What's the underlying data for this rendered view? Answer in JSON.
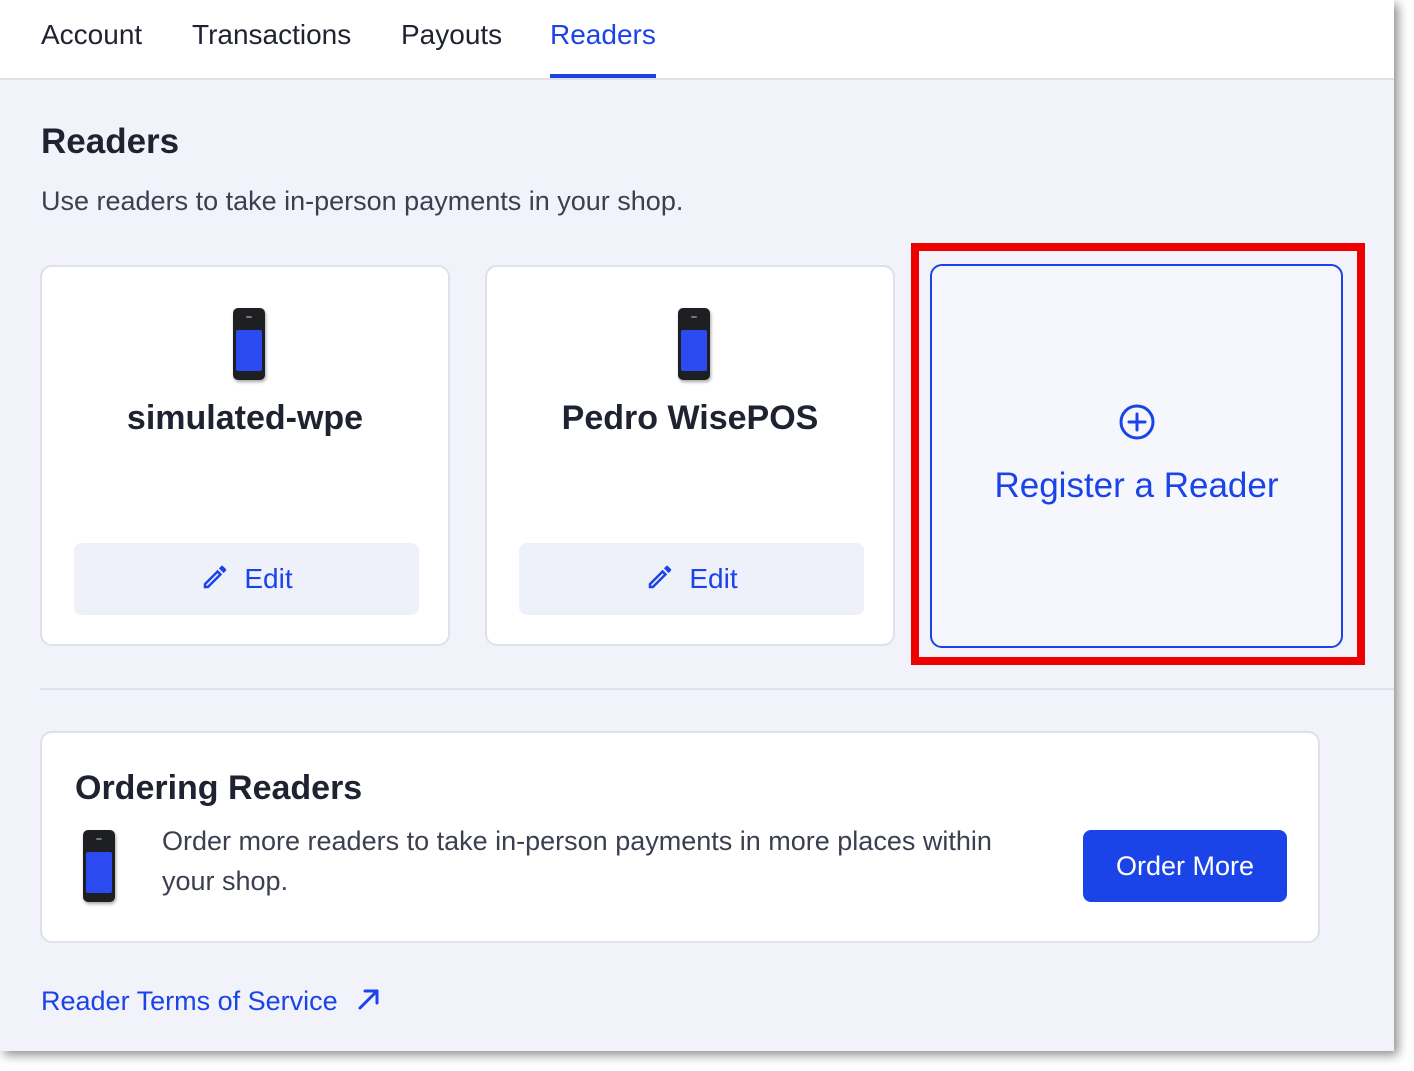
{
  "tabs": [
    {
      "label": "Account",
      "active": false
    },
    {
      "label": "Transactions",
      "active": false
    },
    {
      "label": "Payouts",
      "active": false
    },
    {
      "label": "Readers",
      "active": true
    }
  ],
  "page": {
    "title": "Readers",
    "subtitle": "Use readers to take in-person payments in your shop."
  },
  "readers": [
    {
      "name": "simulated-wpe",
      "edit_label": "Edit",
      "icon": "card-reader-device-icon"
    },
    {
      "name": "Pedro WisePOS",
      "edit_label": "Edit",
      "icon": "card-reader-device-icon"
    }
  ],
  "register": {
    "label": "Register a Reader",
    "icon": "plus-circle-icon",
    "highlighted": true
  },
  "ordering": {
    "title": "Ordering Readers",
    "text": "Order more readers to take in-person payments in more places within your shop.",
    "button_label": "Order More"
  },
  "terms": {
    "label": "Reader Terms of Service",
    "icon": "external-link-arrow-icon"
  },
  "colors": {
    "accent": "#1b44e8",
    "background": "#f1f2fa",
    "highlight": "#ee0000",
    "text": "#1f2230"
  }
}
